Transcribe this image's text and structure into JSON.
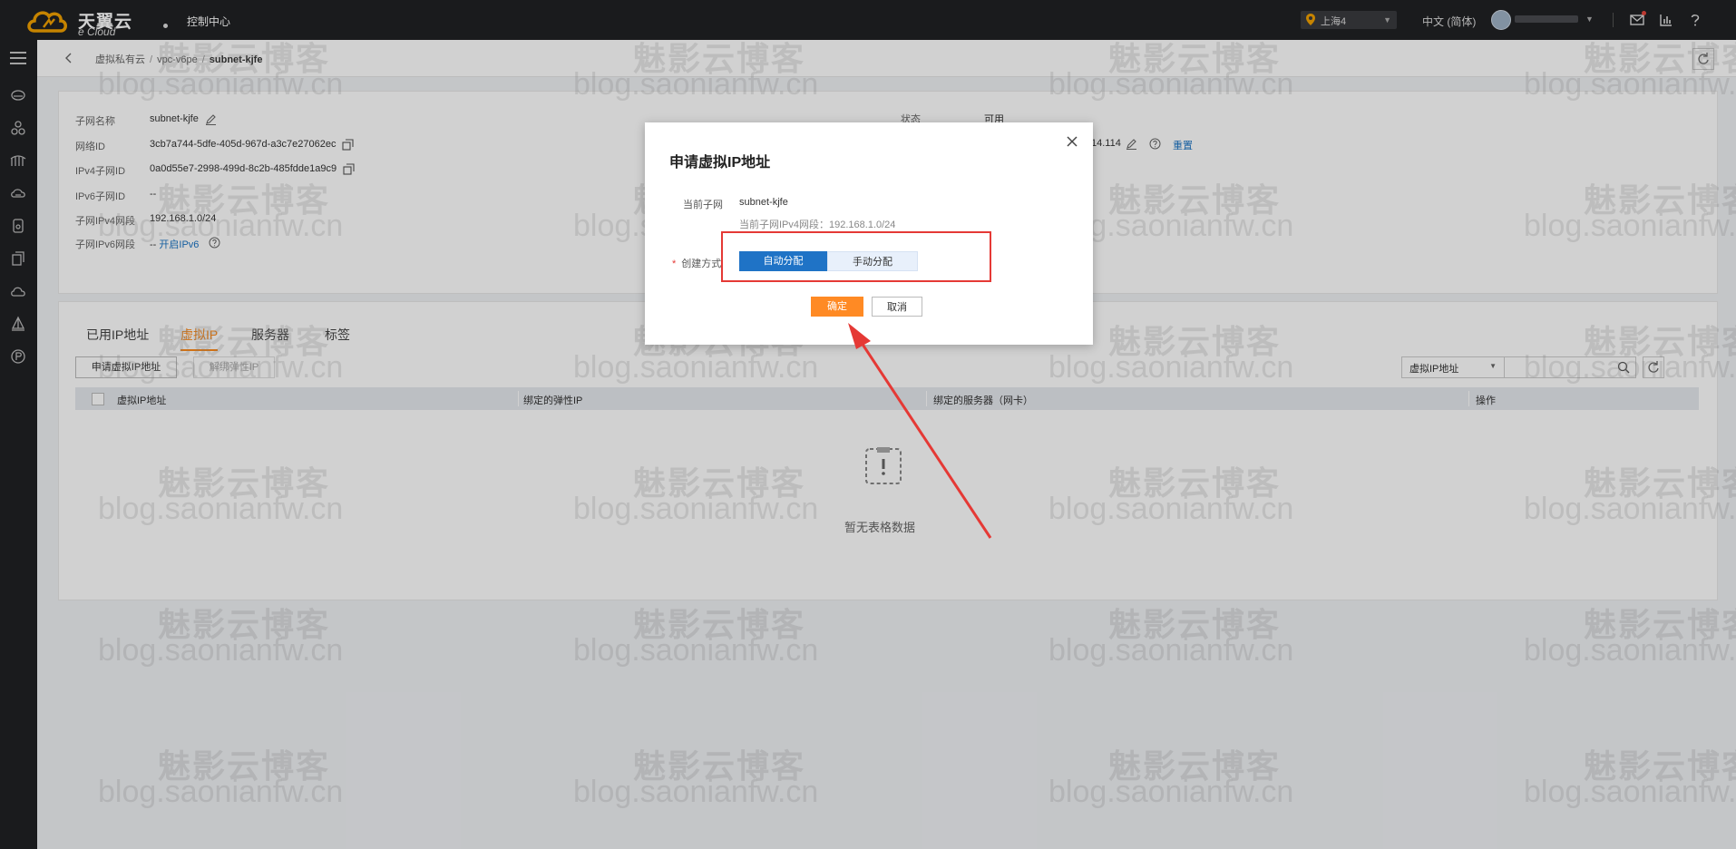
{
  "header": {
    "brand_cn": "天翼云",
    "brand_en": "e Cloud",
    "console_label": "控制中心",
    "region": "上海4",
    "language": "中文 (简体)",
    "icons": [
      "mail-icon",
      "chart-icon",
      "help-icon"
    ]
  },
  "sidebar": {
    "icons": [
      "menu-icon",
      "cloud-server-icon",
      "cluster-icon",
      "network-bridge-icon",
      "cloud-storage-icon",
      "database-icon",
      "copy-icon",
      "cloud-icon",
      "sail-icon",
      "p-icon"
    ]
  },
  "breadcrumb": {
    "items": [
      "虚拟私有云",
      "vpc-v6pe",
      "subnet-kjfe"
    ]
  },
  "subnet_info": {
    "name_label": "子网名称",
    "name_value": "subnet-kjfe",
    "network_id_label": "网络ID",
    "network_id_value": "3cb7a744-5dfe-405d-967d-a3c7e27062ec",
    "ipv4_id_label": "IPv4子网ID",
    "ipv4_id_value": "0a0d55e7-2998-499d-8c2b-485fdde1a9c9",
    "ipv6_id_label": "IPv6子网ID",
    "ipv6_id_value": "--",
    "ipv4_range_label": "子网IPv4网段",
    "ipv4_range_value": "192.168.1.0/24",
    "ipv6_range_label": "子网IPv6网段",
    "ipv6_range_value": "--",
    "ipv6_enable_link": "开启IPv6",
    "status_label": "状态",
    "status_value": "可用",
    "gateway_fragment": "14.114",
    "gateway_link": "重置"
  },
  "tabs": {
    "items": [
      "已用IP地址",
      "虚拟IP",
      "服务器",
      "标签"
    ],
    "active_index": 1
  },
  "toolbar": {
    "apply_vip_button": "申请虚拟IP地址",
    "unbind_eip_button": "解绑弹性IP",
    "filter_select": "虚拟IP地址"
  },
  "table": {
    "columns": [
      "虚拟IP地址",
      "绑定的弹性IP",
      "绑定的服务器（网卡）",
      "操作"
    ],
    "rows": [],
    "empty_text": "暂无表格数据"
  },
  "modal": {
    "title": "申请虚拟IP地址",
    "current_subnet_label": "当前子网",
    "current_subnet_value": "subnet-kjfe",
    "subnet_range_text": "当前子网IPv4网段：192.168.1.0/24",
    "create_method_label": "创建方式",
    "option_auto": "自动分配",
    "option_manual": "手动分配",
    "selected_option": "自动分配",
    "confirm_button": "确定",
    "cancel_button": "取消"
  },
  "watermark": {
    "cn": "魅影云博客",
    "en": "blog.saonianfw.cn"
  },
  "colors": {
    "accent_orange": "#ff8a24",
    "primary_blue": "#1f73c6",
    "highlight_red": "#e53935",
    "topbar": "#202124"
  }
}
